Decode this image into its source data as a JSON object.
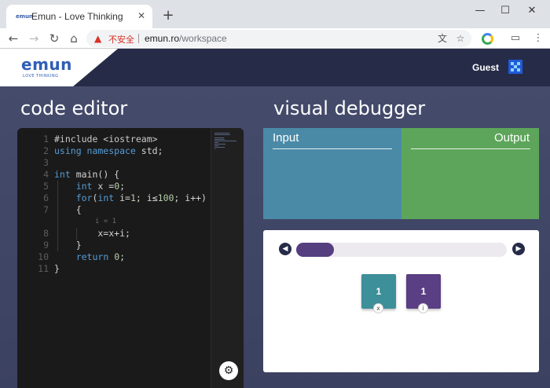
{
  "browser": {
    "tab_title": "Emun - Love Thinking",
    "tab_favicon": "emun",
    "security_label": "不安全",
    "url_host": "emun.ro",
    "url_path": "/workspace",
    "icons": [
      "back-icon",
      "forward-icon",
      "reload-icon",
      "home-icon",
      "warning-icon",
      "translate-icon",
      "star-icon",
      "extension-icon",
      "cast-icon",
      "menu-icon"
    ]
  },
  "header": {
    "logo": "emun",
    "tagline": "LOVE THINKING",
    "user": "Guest"
  },
  "editor": {
    "title": "code editor",
    "lines": [
      {
        "n": "1",
        "parts": [
          [
            "pp",
            "#include <iostream>"
          ]
        ]
      },
      {
        "n": "2",
        "parts": [
          [
            "kw",
            "using namespace"
          ],
          [
            "",
            " std;"
          ]
        ]
      },
      {
        "n": "3",
        "parts": []
      },
      {
        "n": "4",
        "parts": [
          [
            "kw",
            "int"
          ],
          [
            "",
            " main() {"
          ]
        ]
      },
      {
        "n": "5",
        "parts": [
          [
            "",
            "    "
          ],
          [
            "kw",
            "int"
          ],
          [
            "",
            " x ="
          ],
          [
            "num",
            "0"
          ],
          [
            "",
            ";"
          ]
        ]
      },
      {
        "n": "6",
        "parts": [
          [
            "",
            "    "
          ],
          [
            "kw",
            "for"
          ],
          [
            "",
            "("
          ],
          [
            "kw",
            "int"
          ],
          [
            "",
            " i="
          ],
          [
            "num",
            "1"
          ],
          [
            "",
            "; i"
          ],
          [
            "",
            "≤"
          ],
          [
            "num",
            "100"
          ],
          [
            "",
            "; i++)"
          ]
        ]
      },
      {
        "n": "7",
        "parts": [
          [
            "",
            "    {"
          ]
        ]
      },
      {
        "n": "8",
        "parts": [
          [
            "",
            "        x=x+i;"
          ]
        ]
      },
      {
        "n": "9",
        "parts": [
          [
            "",
            "    }"
          ]
        ]
      },
      {
        "n": "10",
        "parts": [
          [
            "",
            "    "
          ],
          [
            "kw",
            "return"
          ],
          [
            "",
            " "
          ],
          [
            "num",
            "0"
          ],
          [
            "",
            ";"
          ]
        ]
      },
      {
        "n": "11",
        "parts": [
          [
            "",
            "}"
          ]
        ]
      }
    ],
    "inline_hint": "i = 1"
  },
  "debugger": {
    "title": "visual debugger",
    "input_label": "Input",
    "output_label": "Output",
    "progress": 0.18,
    "variables": [
      {
        "value": "1",
        "tag": "x",
        "color": "#3d8f99"
      },
      {
        "value": "1",
        "tag": "i",
        "color": "#5a3f84"
      }
    ]
  }
}
